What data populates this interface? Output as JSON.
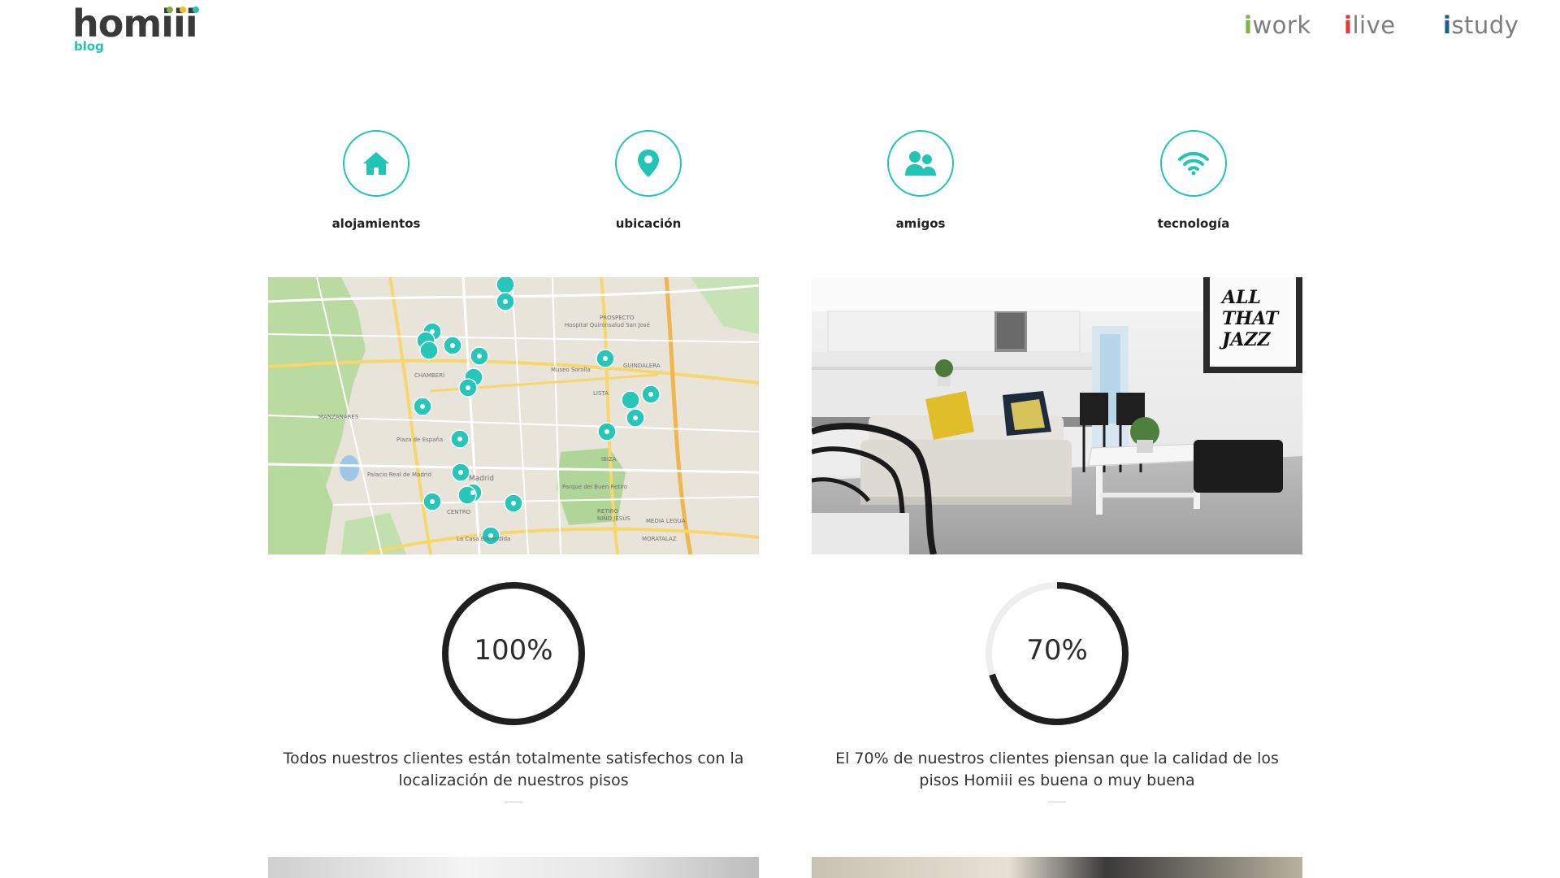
{
  "header": {
    "logo_text": "homiii",
    "logo_sub": "blog",
    "brands": [
      {
        "prefix": "i",
        "suffix": "work",
        "color": "#7cb342"
      },
      {
        "prefix": "i",
        "suffix": "live",
        "color": "#e53935"
      },
      {
        "prefix": "i",
        "suffix": "study",
        "color": "#1e5f8c"
      }
    ]
  },
  "categories": [
    {
      "label": "alojamientos",
      "icon": "home-icon"
    },
    {
      "label": "ubicación",
      "icon": "map-pin-icon"
    },
    {
      "label": "amigos",
      "icon": "users-icon"
    },
    {
      "label": "tecnología",
      "icon": "wifi-icon"
    }
  ],
  "stats": [
    {
      "value": "100%",
      "fraction": 1.0,
      "description": "Todos nuestros clientes están totalmente satisfechos con la localización de nuestros pisos"
    },
    {
      "value": "70%",
      "fraction": 0.7,
      "description": "El 70% de nuestros clientes piensan que la calidad de los pisos Homiii es buena o muy buena"
    }
  ],
  "map_labels": [
    "CHAMBERÍ",
    "MANZANARES",
    "CENTRO",
    "RETIRO",
    "Madrid",
    "PROSPECTO",
    "GUINDALERA",
    "LISTA",
    "IBIZA",
    "MEDIA LEGUA",
    "MORATALAZ",
    "NIÑO JESÚS",
    "Parque del Buen Retiro",
    "Palacio Real de Madrid",
    "Museo Sorolla",
    "Hospital Quirónsalud San José",
    "Plaza de España",
    "La Casa Encendida"
  ],
  "poster_text": [
    "ALL",
    "THAT",
    "JAZZ"
  ],
  "colors": {
    "accent": "#22c4b6",
    "ring": "#1f1f1f",
    "track": "#eeeeee"
  }
}
